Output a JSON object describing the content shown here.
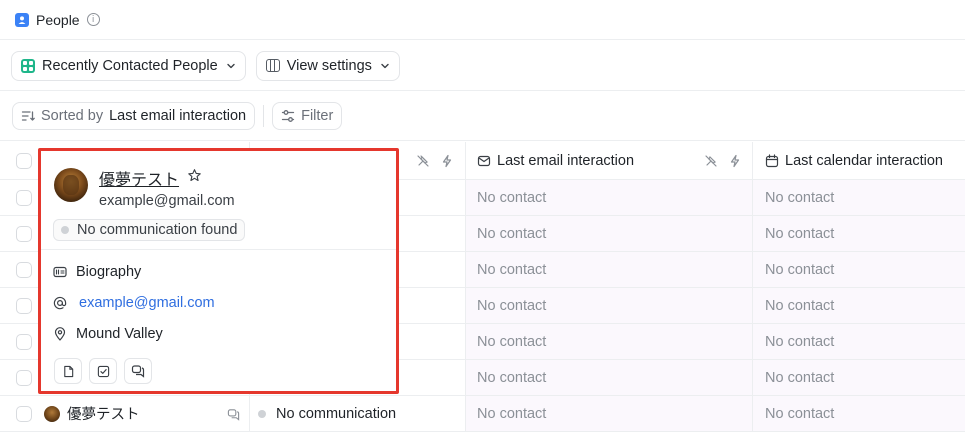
{
  "app": {
    "title": "People"
  },
  "toolbar": {
    "view_name": "Recently Contacted People",
    "view_settings_label": "View settings",
    "sorted_by_label": "Sorted by",
    "sort_field": "Last email interaction",
    "filter_label": "Filter"
  },
  "columns": [
    {
      "label": "Last email interaction"
    },
    {
      "label": "Last calendar interaction"
    }
  ],
  "rows": [
    {
      "email": "No contact",
      "calendar": "No contact"
    },
    {
      "email": "No contact",
      "calendar": "No contact"
    },
    {
      "email": "No contact",
      "calendar": "No contact"
    },
    {
      "email": "No contact",
      "calendar": "No contact"
    },
    {
      "email": "No contact",
      "calendar": "No contact"
    },
    {
      "email": "No contact",
      "calendar": "No contact"
    },
    {
      "name": "優夢テスト",
      "communication": "No communication",
      "email": "No contact",
      "calendar": "No contact"
    }
  ],
  "popover": {
    "name": "優夢テスト",
    "email": "example@gmail.com",
    "status_badge": "No communication found",
    "details": {
      "biography_label": "Biography",
      "email_link": "example@gmail.com",
      "location": "Mound Valley"
    },
    "highlight_color": "#e5372d"
  },
  "colors": {
    "accent_blue": "#3b82f6",
    "view_green": "#1fb68a",
    "link": "#2f6ee0",
    "muted": "#8b9097"
  }
}
